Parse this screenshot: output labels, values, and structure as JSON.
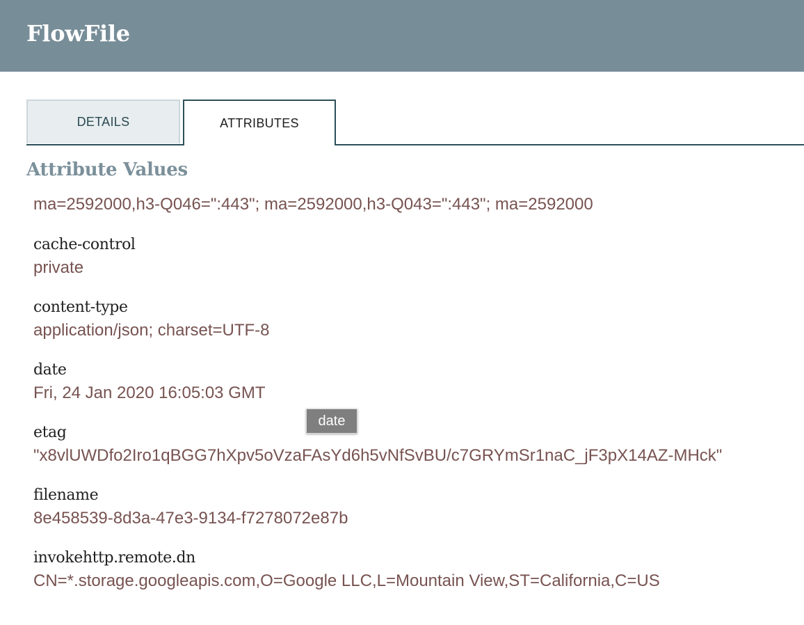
{
  "header": {
    "title": "FlowFile"
  },
  "tabs": [
    {
      "label": "DETAILS",
      "active": false
    },
    {
      "label": "ATTRIBUTES",
      "active": true
    }
  ],
  "section": {
    "title": "Attribute Values"
  },
  "attributes": [
    {
      "name": "",
      "value": "ma=2592000,h3-Q046=\":443\"; ma=2592000,h3-Q043=\":443\"; ma=2592000"
    },
    {
      "name": "cache-control",
      "value": "private"
    },
    {
      "name": "content-type",
      "value": "application/json; charset=UTF-8"
    },
    {
      "name": "date",
      "value": "Fri, 24 Jan 2020 16:05:03 GMT"
    },
    {
      "name": "etag",
      "value": "\"x8vlUWDfo2Iro1qBGG7hXpv5oVzaFAsYd6h5vNfSvBU/c7GRYmSr1naC_jF3pX14AZ-MHck\""
    },
    {
      "name": "filename",
      "value": "8e458539-8d3a-47e3-9134-f7278072e87b"
    },
    {
      "name": "invokehttp.remote.dn",
      "value": "CN=*.storage.googleapis.com,O=Google LLC,L=Mountain View,ST=California,C=US"
    }
  ],
  "tooltip": {
    "text": "date"
  },
  "colors": {
    "header_bg": "#778d98",
    "tab_border": "#2c4f58",
    "section_title": "#7b909a",
    "attr_value": "#775351",
    "tooltip_bg": "#7f7f7f"
  }
}
